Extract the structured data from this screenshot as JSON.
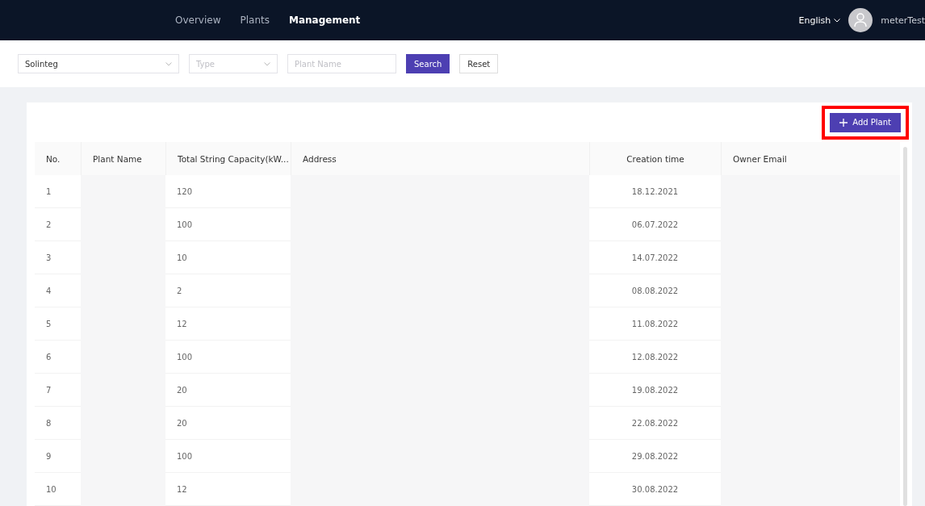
{
  "nav": {
    "items": [
      {
        "label": "Overview",
        "selected": false
      },
      {
        "label": "Plants",
        "selected": false
      },
      {
        "label": "Management",
        "selected": true
      }
    ],
    "language": "English",
    "user": "meterTest"
  },
  "filters": {
    "company": {
      "value": "Solinteg"
    },
    "type": {
      "placeholder": "Type"
    },
    "plant_name": {
      "placeholder": "Plant Name"
    },
    "buttons": [
      "Search",
      "Reset"
    ]
  },
  "add_plant_button": {
    "label": "Add Plant",
    "highlighted": true
  },
  "table": {
    "columns": [
      "No.",
      "Plant Name",
      "Total String Capacity(kW...",
      "Address",
      "Creation time",
      "Owner Email"
    ],
    "rows": [
      {
        "no": "1",
        "capacity": "120",
        "created": "18.12.2021"
      },
      {
        "no": "2",
        "capacity": "100",
        "created": "06.07.2022"
      },
      {
        "no": "3",
        "capacity": "10",
        "created": "14.07.2022"
      },
      {
        "no": "4",
        "capacity": "2",
        "created": "08.08.2022"
      },
      {
        "no": "5",
        "capacity": "12",
        "created": "11.08.2022"
      },
      {
        "no": "6",
        "capacity": "100",
        "created": "12.08.2022"
      },
      {
        "no": "7",
        "capacity": "20",
        "created": "19.08.2022"
      },
      {
        "no": "8",
        "capacity": "20",
        "created": "22.08.2022"
      },
      {
        "no": "9",
        "capacity": "100",
        "created": "29.08.2022"
      },
      {
        "no": "10",
        "capacity": "12",
        "created": "30.08.2022"
      }
    ]
  }
}
